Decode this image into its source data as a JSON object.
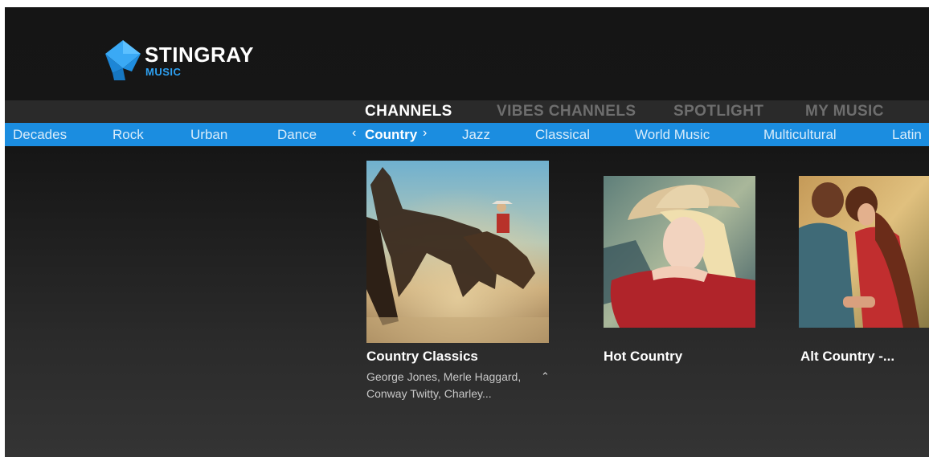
{
  "brand": {
    "name": "STINGRAY",
    "subname": "MUSIC",
    "accent": "#2ea1f2"
  },
  "main_tabs": [
    {
      "label": "CHANNELS",
      "active": true
    },
    {
      "label": "VIBES CHANNELS",
      "active": false
    },
    {
      "label": "SPOTLIGHT",
      "active": false
    },
    {
      "label": "MY MUSIC",
      "active": false
    }
  ],
  "genres": [
    {
      "label": "Decades",
      "active": false
    },
    {
      "label": "Rock",
      "active": false
    },
    {
      "label": "Urban",
      "active": false
    },
    {
      "label": "Dance",
      "active": false
    },
    {
      "label": "Country",
      "active": true
    },
    {
      "label": "Jazz",
      "active": false
    },
    {
      "label": "Classical",
      "active": false
    },
    {
      "label": "World Music",
      "active": false
    },
    {
      "label": "Multicultural",
      "active": false
    },
    {
      "label": "Latin",
      "active": false
    }
  ],
  "genre_nav": {
    "prev_glyph": "‹",
    "next_glyph": "›"
  },
  "cards": [
    {
      "title": "Country Classics",
      "description": "George Jones, Merle Haggard, Conway Twitty, Charley...",
      "image": "cowboy-on-horse-art",
      "expanded": true,
      "collapse_glyph": "⌃"
    },
    {
      "title": "Hot Country",
      "description": "",
      "image": "woman-in-cowboy-hat-art",
      "expanded": false
    },
    {
      "title": "Alt Country -...",
      "description": "",
      "image": "couple-embracing-art",
      "expanded": false
    }
  ],
  "colors": {
    "genre_bar": "#1b8de0",
    "tab_bar": "#2a2a2a",
    "inactive_tab": "#6e6e6e"
  }
}
